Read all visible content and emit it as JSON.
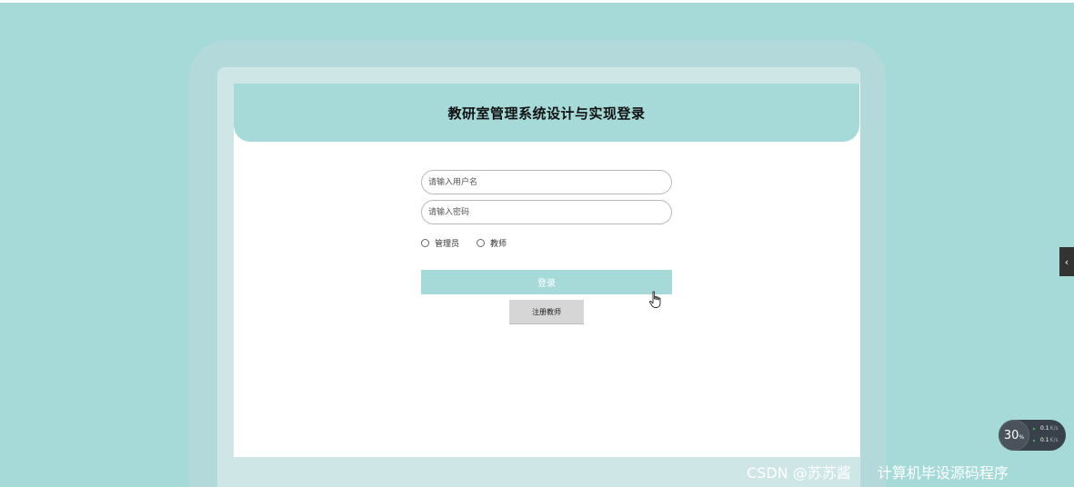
{
  "header": {
    "title": "教研室管理系统设计与实现登录"
  },
  "form": {
    "username_placeholder": "请输入用户名",
    "password_placeholder": "请输入密码",
    "roles": [
      {
        "label": "管理员"
      },
      {
        "label": "教师"
      }
    ],
    "login_label": "登录",
    "register_label": "注册教师"
  },
  "side_toggle": {
    "icon": "chevron-left-icon",
    "glyph": "‹"
  },
  "overlay": {
    "fps_value": "30",
    "fps_unit": "%",
    "net_up": "0.1",
    "net_down": "0.1",
    "net_unit": "K/s"
  },
  "watermark": {
    "left": "CSDN @苏苏酱",
    "right": "计算机毕设源码程序"
  },
  "colors": {
    "page_background": "#a6dad9",
    "header_background": "#a6dad9",
    "login_button": "#a6dad9",
    "register_button": "#d6d6d6"
  }
}
